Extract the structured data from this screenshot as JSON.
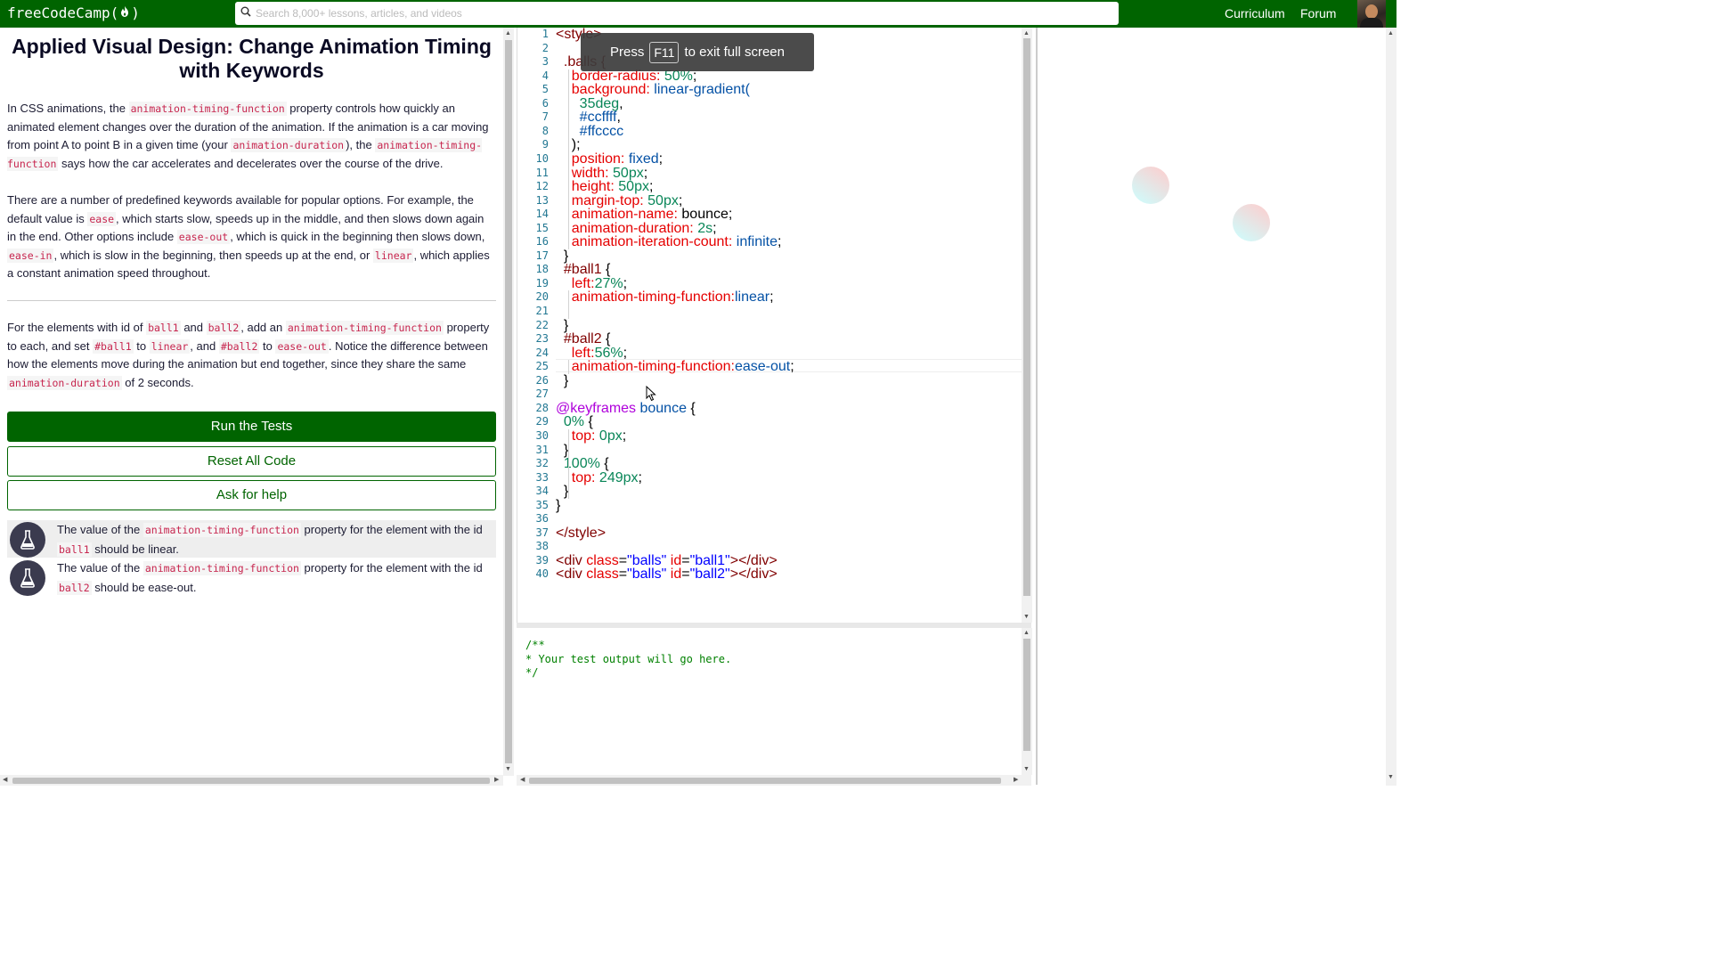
{
  "navbar": {
    "logo_text": "freeCodeCamp(",
    "logo_end": ")",
    "search_placeholder": "Search 8,000+ lessons, articles, and videos",
    "links": [
      "Curriculum",
      "Forum"
    ]
  },
  "lesson": {
    "title": "Applied Visual Design: Change Animation Timing with Keywords",
    "p1": [
      "In CSS animations, the ",
      "animation-timing-function",
      " property controls how quickly an animated element changes over the duration of the animation. If the animation is a car moving from point A to point B in a given time (your ",
      "animation-duration",
      "), the ",
      "animation-timing-function",
      " says how the car accelerates and decelerates over the course of the drive."
    ],
    "p2": [
      "There are a number of predefined keywords available for popular options. For example, the default value is ",
      "ease",
      ", which starts slow, speeds up in the middle, and then slows down again in the end. Other options include ",
      "ease-out",
      ", which is quick in the beginning then slows down, ",
      "ease-in",
      ", which is slow in the beginning, then speeds up at the end, or ",
      "linear",
      ", which applies a constant animation speed throughout."
    ],
    "p3": [
      "For the elements with id of ",
      "ball1",
      " and ",
      "ball2",
      ", add an ",
      "animation-timing-function",
      " property to each, and set ",
      "#ball1",
      " to ",
      "linear",
      ", and ",
      "#ball2",
      " to ",
      "ease-out",
      ". Notice the difference between how the elements move during the animation but end together, since they share the same ",
      "animation-duration",
      " of 2 seconds."
    ]
  },
  "buttons": {
    "run": "Run the Tests",
    "reset": "Reset All Code",
    "help": "Ask for help"
  },
  "tests": [
    [
      "The value of the ",
      "animation-timing-function",
      " property for the element with the id ",
      "ball1",
      " should be linear."
    ],
    [
      "The value of the ",
      "animation-timing-function",
      " property for the element with the id ",
      "ball2",
      " should be ease-out."
    ]
  ],
  "toast": {
    "press": "Press",
    "key": "F11",
    "rest": "to exit full screen"
  },
  "code_lines": [
    [
      [
        "tag",
        "<style>"
      ]
    ],
    [],
    [
      [
        "sel",
        "  .balls {"
      ]
    ],
    [
      [
        "prop",
        "    border-radius: "
      ],
      [
        "num",
        "50%"
      ],
      [
        "plain",
        ";"
      ]
    ],
    [
      [
        "prop",
        "    background: "
      ],
      [
        "val",
        "linear-gradient("
      ]
    ],
    [
      [
        "num",
        "      35deg"
      ],
      [
        "plain",
        ","
      ]
    ],
    [
      [
        "val",
        "      #ccffff"
      ],
      [
        "plain",
        ","
      ]
    ],
    [
      [
        "val",
        "      #ffcccc"
      ]
    ],
    [
      [
        "plain",
        "    );"
      ]
    ],
    [
      [
        "prop",
        "    position: "
      ],
      [
        "val",
        "fixed"
      ],
      [
        "plain",
        ";"
      ]
    ],
    [
      [
        "prop",
        "    width: "
      ],
      [
        "num",
        "50px"
      ],
      [
        "plain",
        ";"
      ]
    ],
    [
      [
        "prop",
        "    height: "
      ],
      [
        "num",
        "50px"
      ],
      [
        "plain",
        ";"
      ]
    ],
    [
      [
        "prop",
        "    margin-top: "
      ],
      [
        "num",
        "50px"
      ],
      [
        "plain",
        ";"
      ]
    ],
    [
      [
        "prop",
        "    animation-name: "
      ],
      [
        "plain",
        "bounce;"
      ]
    ],
    [
      [
        "prop",
        "    animation-duration: "
      ],
      [
        "num",
        "2s"
      ],
      [
        "plain",
        ";"
      ]
    ],
    [
      [
        "prop",
        "    animation-iteration-count: "
      ],
      [
        "val",
        "infinite"
      ],
      [
        "plain",
        ";"
      ]
    ],
    [
      [
        "plain",
        "  }"
      ]
    ],
    [
      [
        "sel",
        "  #ball1 "
      ],
      [
        "plain",
        "{"
      ]
    ],
    [
      [
        "prop",
        "    left:"
      ],
      [
        "num",
        "27%"
      ],
      [
        "plain",
        ";"
      ]
    ],
    [
      [
        "prop",
        "    animation-timing-function:"
      ],
      [
        "val",
        "linear"
      ],
      [
        "plain",
        ";"
      ]
    ],
    [],
    [
      [
        "plain",
        "  }"
      ]
    ],
    [
      [
        "sel",
        "  #ball2 "
      ],
      [
        "plain",
        "{"
      ]
    ],
    [
      [
        "prop",
        "    left:"
      ],
      [
        "num",
        "56%"
      ],
      [
        "plain",
        ";"
      ]
    ],
    [
      [
        "prop",
        "    animation-timing-function:"
      ],
      [
        "val",
        "ease-out"
      ],
      [
        "plain",
        ";"
      ]
    ],
    [
      [
        "plain",
        "  }"
      ]
    ],
    [],
    [
      [
        "at",
        "@keyframes "
      ],
      [
        "val",
        "bounce "
      ],
      [
        "plain",
        "{"
      ]
    ],
    [
      [
        "num",
        "  0% "
      ],
      [
        "plain",
        "{"
      ]
    ],
    [
      [
        "prop",
        "    top: "
      ],
      [
        "num",
        "0px"
      ],
      [
        "plain",
        ";"
      ]
    ],
    [
      [
        "plain",
        "  }"
      ]
    ],
    [
      [
        "num",
        "  100% "
      ],
      [
        "plain",
        "{"
      ]
    ],
    [
      [
        "prop",
        "    top: "
      ],
      [
        "num",
        "249px"
      ],
      [
        "plain",
        ";"
      ]
    ],
    [
      [
        "plain",
        "  }"
      ]
    ],
    [
      [
        "plain",
        "}"
      ]
    ],
    [],
    [
      [
        "tag",
        "</style>"
      ]
    ],
    [],
    [
      [
        "tag",
        "<div "
      ],
      [
        "attr",
        "class"
      ],
      [
        "plain",
        "="
      ],
      [
        "str",
        "\"balls\" "
      ],
      [
        "attr",
        "id"
      ],
      [
        "plain",
        "="
      ],
      [
        "str",
        "\"ball1\""
      ],
      [
        "tag",
        "></div>"
      ]
    ],
    [
      [
        "tag",
        "<div "
      ],
      [
        "attr",
        "class"
      ],
      [
        "plain",
        "="
      ],
      [
        "str",
        "\"balls\" "
      ],
      [
        "attr",
        "id"
      ],
      [
        "plain",
        "="
      ],
      [
        "str",
        "\"ball2\""
      ],
      [
        "tag",
        "></div>"
      ]
    ]
  ],
  "console_lines": [
    "/**",
    "* Your test output will go here.",
    "*/"
  ]
}
